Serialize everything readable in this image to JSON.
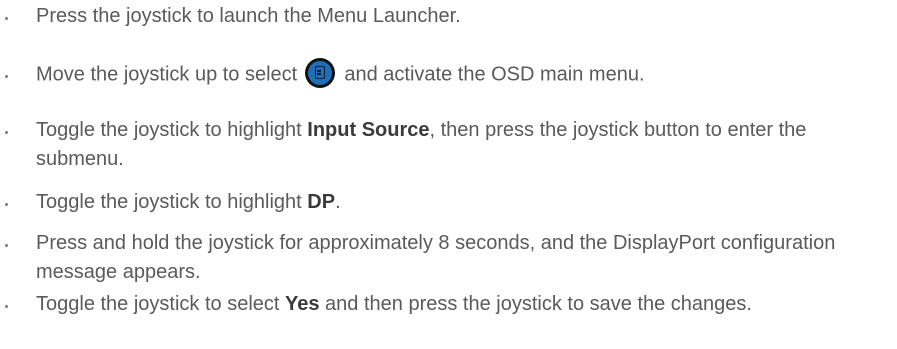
{
  "steps": [
    {
      "text": "Press the joystick to launch the Menu Launcher."
    },
    {
      "before": "Move the joystick up to select ",
      "icon": "osd-menu-icon",
      "after": " and activate the OSD main menu."
    },
    {
      "before": "Toggle the joystick to highlight ",
      "bold": "Input Source",
      "after": ", then press the joystick button to enter the submenu."
    },
    {
      "before": "Toggle the joystick to highlight ",
      "bold": "DP",
      "after": "."
    },
    {
      "text": "Press and hold the joystick for approximately 8 seconds, and the DisplayPort configuration message appears."
    },
    {
      "before": "Toggle the joystick to select ",
      "bold": "Yes",
      "after": " and then press the joystick to save the changes."
    }
  ],
  "colors": {
    "text": "#5a5a5a",
    "bold_text": "#3a3a3a",
    "icon_blue": "#1e6fb8",
    "icon_ring": "#111111"
  }
}
